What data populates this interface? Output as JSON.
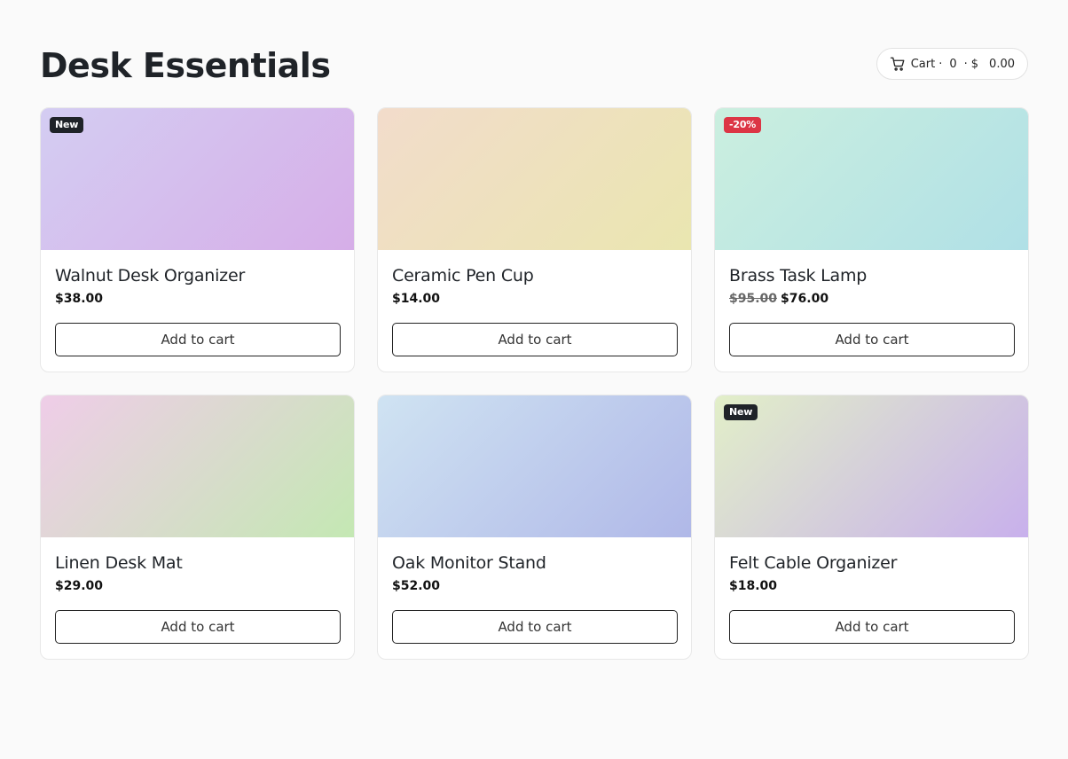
{
  "page": {
    "title": "Desk Essentials"
  },
  "cart": {
    "label": "Cart",
    "sep1": "·",
    "count": "0",
    "sep2": "·",
    "currency": "$",
    "total": "0.00",
    "icon": "cart-icon"
  },
  "products": [
    {
      "name": "Walnut Desk Organizer",
      "price": "$38.00",
      "old_price": "",
      "badge": "New",
      "badge_type": "new",
      "button": "Add to cart",
      "gradient": [
        "#d4cdf2",
        "#d6aee8"
      ]
    },
    {
      "name": "Ceramic Pen Cup",
      "price": "$14.00",
      "old_price": "",
      "badge": "",
      "badge_type": "",
      "button": "Add to cart",
      "gradient": [
        "#f2dccb",
        "#eae6b0"
      ]
    },
    {
      "name": "Brass Task Lamp",
      "price": "$76.00",
      "old_price": "$95.00",
      "badge": "-20%",
      "badge_type": "sale",
      "button": "Add to cart",
      "gradient": [
        "#cbefdf",
        "#b0e0e6"
      ]
    },
    {
      "name": "Linen Desk Mat",
      "price": "$29.00",
      "old_price": "",
      "badge": "",
      "badge_type": "",
      "button": "Add to cart",
      "gradient": [
        "#efcde8",
        "#c4e8b3"
      ]
    },
    {
      "name": "Oak Monitor Stand",
      "price": "$52.00",
      "old_price": "",
      "badge": "",
      "badge_type": "",
      "button": "Add to cart",
      "gradient": [
        "#cfe3f2",
        "#b0b8e8"
      ]
    },
    {
      "name": "Felt Cable Organizer",
      "price": "$18.00",
      "old_price": "",
      "badge": "New",
      "badge_type": "new",
      "button": "Add to cart",
      "gradient": [
        "#e2efc8",
        "#c8b0ec"
      ]
    }
  ]
}
